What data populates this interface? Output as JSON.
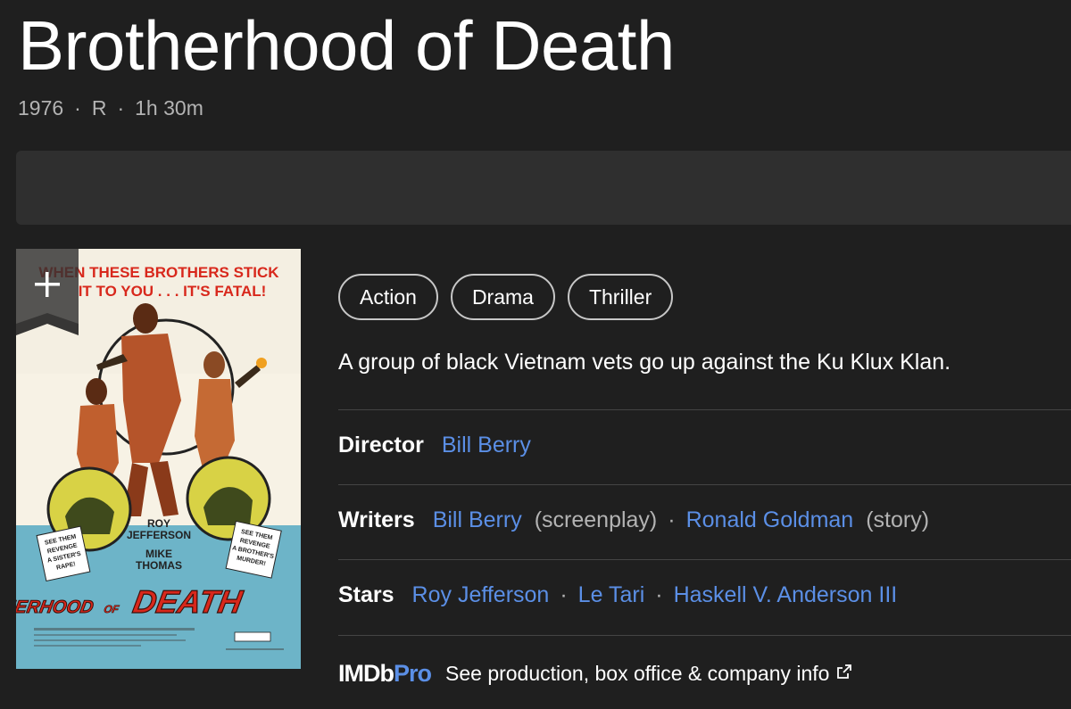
{
  "title": "Brotherhood of Death",
  "meta": {
    "year": "1976",
    "rating": "R",
    "runtime": "1h 30m",
    "separator": "·"
  },
  "poster": {
    "tagline_1": "WHEN THESE BROTHERS STICK",
    "tagline_2": "IT TO YOU . . . IT'S FATAL!",
    "cast_1": "ROY",
    "cast_2": "JEFFERSON",
    "cast_3": "MIKE",
    "cast_4": "THOMAS",
    "left_note_1": "SEE THEM",
    "left_note_2": "REVENGE",
    "left_note_3": "A SISTER'S",
    "left_note_4": "RAPE!",
    "right_note_1": "SEE THEM",
    "right_note_2": "REVENGE",
    "right_note_3": "A BROTHER'S",
    "right_note_4": "MURDER!",
    "logo_left": "BROTHERHOOD",
    "logo_mid": "OF",
    "logo_right": "DEATH",
    "watchlist_icon": "plus-icon"
  },
  "genres": [
    "Action",
    "Drama",
    "Thriller"
  ],
  "plot": "A group of black Vietnam vets go up against the Ku Klux Klan.",
  "director": {
    "label": "Director",
    "names": [
      "Bill Berry"
    ]
  },
  "writers": {
    "label": "Writers",
    "items": [
      {
        "name": "Bill Berry",
        "role": "(screenplay)"
      },
      {
        "name": "Ronald Goldman",
        "role": "(story)"
      }
    ]
  },
  "stars": {
    "label": "Stars",
    "names": [
      "Roy Jefferson",
      "Le Tari",
      "Haskell V. Anderson III"
    ]
  },
  "imdbpro": {
    "logo_imdb": "IMDb",
    "logo_pro": "Pro",
    "text": "See production, box office & company info",
    "icon": "external-link-icon"
  },
  "colors": {
    "background": "#1f1f1f",
    "link": "#5b8fe6",
    "muted": "#b3b3b3"
  }
}
